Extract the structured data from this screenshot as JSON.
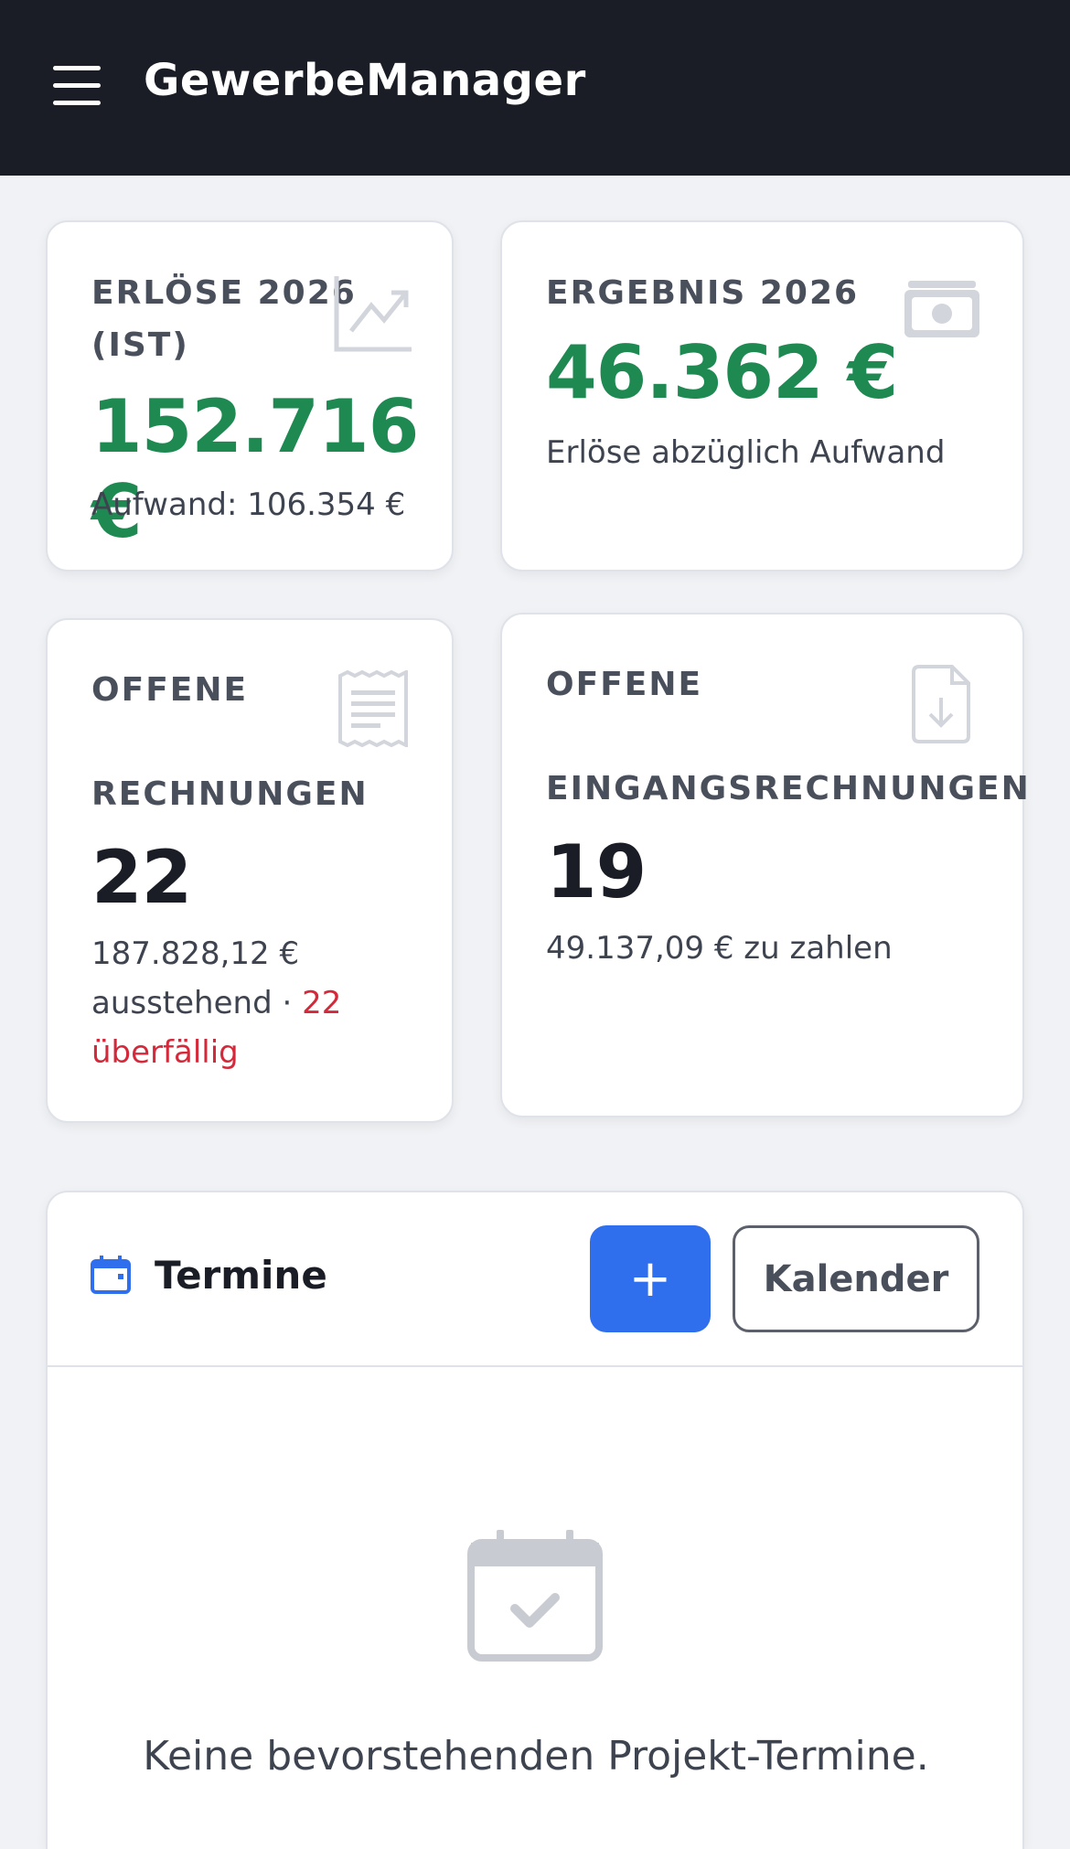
{
  "app": {
    "title": "GewerbeManager"
  },
  "kpis": {
    "revenue": {
      "label_line1": "ERLÖSE 2026",
      "label_line2": "(IST)",
      "value": "152.716 €",
      "sub": "Aufwand: 106.354 €",
      "icon": "trend-up-icon"
    },
    "result": {
      "label": "ERGEBNIS 2026",
      "value": "46.362 €",
      "sub": "Erlöse abzüglich Aufwand",
      "icon": "banknote-icon"
    },
    "open_invoices": {
      "label_line1": "OFFENE",
      "label_line2": "RECHNUNGEN",
      "value": "22",
      "sub_line1": "187.828,12 €",
      "sub_line2": "ausstehend · ",
      "overdue_count": "22",
      "overdue_label": "überfällig",
      "icon": "receipt-icon"
    },
    "open_incoming": {
      "label_line1": "OFFENE",
      "label_line2": "EINGANGSRECHNUNGEN",
      "value": "19",
      "sub": "49.137,09 € zu zahlen",
      "icon": "file-download-icon"
    }
  },
  "appointments": {
    "title": "Termine",
    "add_label": "+",
    "calendar_label": "Kalender",
    "empty_text": "Keine bevorstehenden Projekt-Termine."
  },
  "colors": {
    "topbar": "#1b1d26",
    "accent": "#2f6fed",
    "positive": "#1e8a52",
    "danger": "#d4293a",
    "background": "#f0f2f5"
  }
}
